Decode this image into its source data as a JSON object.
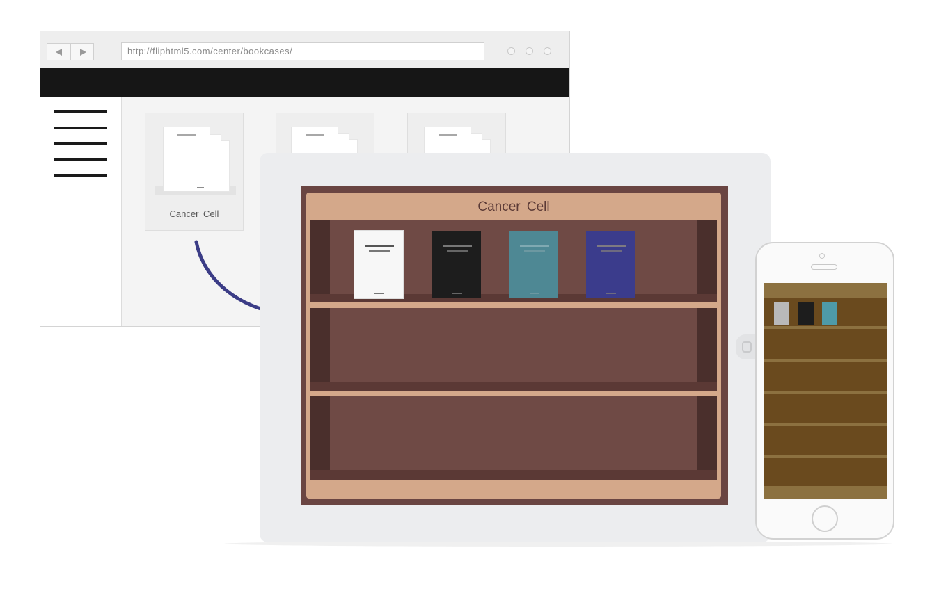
{
  "browser": {
    "url": "http://fliphtml5.com/center/bookcases/",
    "back_icon": "triangle-left",
    "forward_icon": "triangle-right"
  },
  "bookcase_tile": {
    "label": "Cancer  Cell"
  },
  "tablet": {
    "shelf_title": "Cancer  Cell",
    "books": [
      {
        "color": "#f7f7f7"
      },
      {
        "color": "#1d1d1d"
      },
      {
        "color": "#4e8894"
      },
      {
        "color": "#3b3c8c"
      }
    ]
  },
  "phone": {
    "books": [
      {
        "color": "#b9b9b9"
      },
      {
        "color": "#1d1d1d"
      },
      {
        "color": "#4e9aa8"
      }
    ]
  },
  "colors": {
    "arrow": "#3b3c86",
    "shelf_wood": "#d4a88a",
    "shelf_back": "#6f4a45"
  }
}
